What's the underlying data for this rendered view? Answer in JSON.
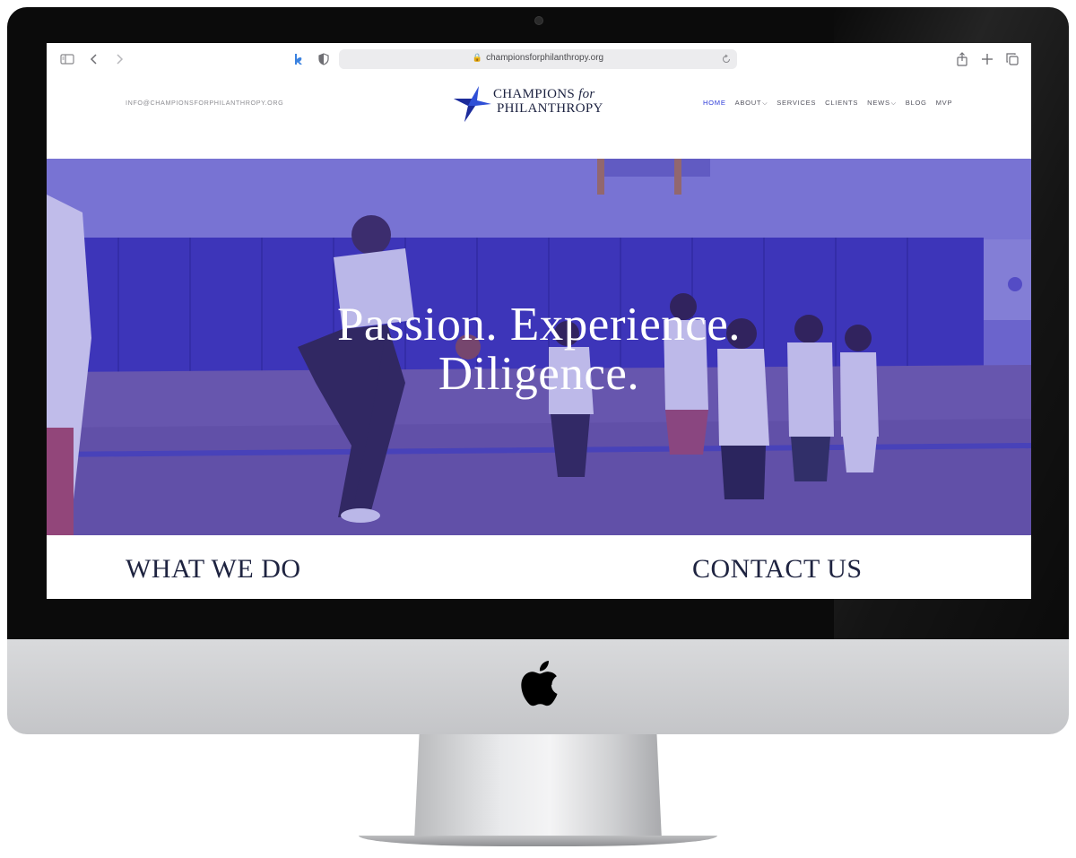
{
  "browser": {
    "url": "championsforphilanthropy.org"
  },
  "site": {
    "email": "INFO@CHAMPIONSFORPHILANTHROPY.ORG",
    "logo": {
      "line1_main": "CHAMPIONS",
      "line1_for": "for",
      "line2": "PHILANTHROPY"
    },
    "nav": [
      {
        "label": "HOME",
        "active": true
      },
      {
        "label": "ABOUT",
        "has_menu": true
      },
      {
        "label": "SERVICES"
      },
      {
        "label": "CLIENTS"
      },
      {
        "label": "NEWS",
        "has_menu": true
      },
      {
        "label": "BLOG"
      },
      {
        "label": "MVP"
      }
    ],
    "nav_caret": "⌵"
  },
  "hero": {
    "line1": "Passion. Experience.",
    "line2": "Diligence."
  },
  "sections": {
    "left_title": "WHAT WE DO",
    "right_title": "CONTACT US"
  },
  "colors": {
    "accent": "#2d3bd8",
    "heading": "#1e2340",
    "hero_tint": "#5a4fd0"
  },
  "icons": [
    "sidebar-icon",
    "back-icon",
    "forward-icon",
    "extension-icon",
    "shield-icon",
    "lock-icon",
    "reload-icon",
    "share-icon",
    "new-tab-icon",
    "tabs-icon",
    "apple-logo-icon"
  ]
}
